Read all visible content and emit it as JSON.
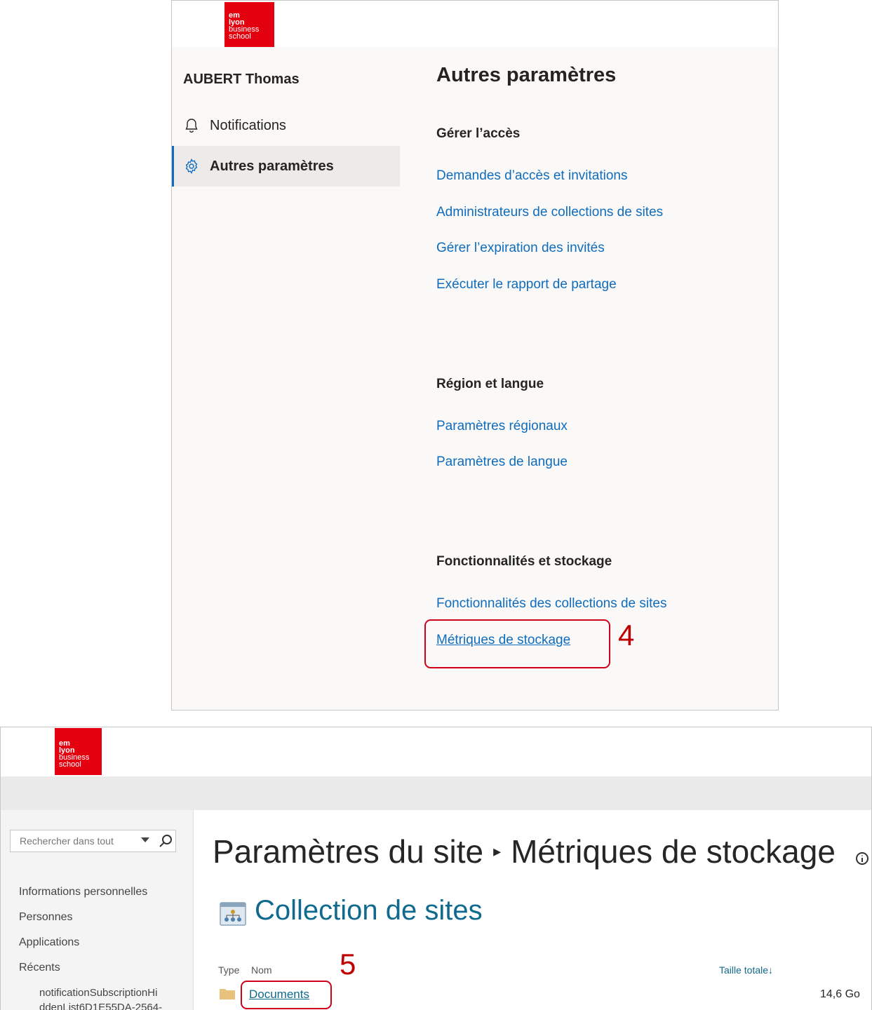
{
  "top_panel": {
    "logo": {
      "line1": "em",
      "line2": "lyon",
      "line3": "business",
      "line4": "school"
    },
    "sidebar": {
      "user_name": "AUBERT Thomas",
      "items": [
        {
          "label": "Notifications",
          "icon": "bell-icon",
          "selected": false
        },
        {
          "label": "Autres paramètres",
          "icon": "gear-icon",
          "selected": true
        }
      ]
    },
    "main": {
      "title": "Autres paramètres",
      "sections": [
        {
          "heading": "Gérer l’accès",
          "links": [
            "Demandes d’accès et invitations",
            "Administrateurs de collections de sites",
            "Gérer l’expiration des invités",
            "Exécuter le rapport de partage"
          ]
        },
        {
          "heading": "Région et langue",
          "links": [
            "Paramètres régionaux",
            "Paramètres de langue"
          ]
        },
        {
          "heading": "Fonctionnalités et stockage",
          "links": [
            "Fonctionnalités des collections de sites",
            "Métriques de stockage"
          ]
        }
      ]
    },
    "step_number": "4"
  },
  "bottom_panel": {
    "logo": {
      "line1": "em",
      "line2": "lyon",
      "line3": "business",
      "line4": "school"
    },
    "search": {
      "placeholder": "Rechercher dans tout"
    },
    "left_nav": {
      "items": [
        "Informations personnelles",
        "Personnes",
        "Applications",
        "Récents"
      ],
      "recent_sub": [
        "notificationSubscriptionHi",
        "ddenList6D1E55DA-2564-"
      ]
    },
    "breadcrumb": {
      "part1": "Paramètres du site",
      "separator": "▸",
      "part2": "Métriques de stockage"
    },
    "collection_title": "Collection de sites",
    "table": {
      "headers": {
        "type": "Type",
        "name": "Nom",
        "total": "Taille totale↓"
      },
      "rows": [
        {
          "name": "Documents",
          "size": "14,6 Go"
        }
      ]
    },
    "step_number": "5"
  },
  "colors": {
    "accent_red": "#e3000f",
    "link_blue": "#0f6cbd",
    "sp_teal": "#106a8e",
    "highlight_red": "#d0021b"
  }
}
